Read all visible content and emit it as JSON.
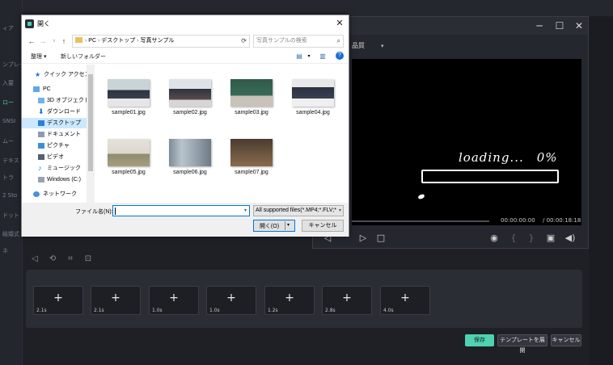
{
  "editor": {
    "left_labels": [
      "ィア",
      "ンプレー",
      "入要",
      "ロー",
      "SNSI",
      "ムー",
      "テキス",
      "トラ",
      "2 Sto",
      "ドット",
      "結婚式",
      "ネ"
    ],
    "preview": {
      "quality_label": "品質",
      "loading_text": "loading...",
      "loading_percent": "0%",
      "timecode_current": "00:00:00:00",
      "timecode_total": "/ 00:00:18:18"
    },
    "slots": [
      {
        "plus": "+",
        "duration": "2.1s"
      },
      {
        "plus": "+",
        "duration": "2.1s"
      },
      {
        "plus": "+",
        "duration": "1.0s"
      },
      {
        "plus": "+",
        "duration": "1.0s"
      },
      {
        "plus": "+",
        "duration": "1.2s"
      },
      {
        "plus": "+",
        "duration": "2.8s"
      },
      {
        "plus": "+",
        "duration": "4.0s"
      }
    ],
    "buttons": {
      "save": "保存",
      "expand_template": "テンプレートを展開",
      "cancel": "キャンセル"
    },
    "accent_color": "#4fd1b2"
  },
  "dialog": {
    "title": "開く",
    "breadcrumb": [
      "PC",
      "デスクトップ",
      "写真サンプル"
    ],
    "search_placeholder": "写真サンプルの検索",
    "toolbar": {
      "organize": "整理",
      "new_folder": "新しいフォルダー"
    },
    "nav_items": [
      {
        "label": "クイック アクセス",
        "icon": "star-icon"
      },
      {
        "label": "PC",
        "icon": "pc-icon"
      },
      {
        "label": "3D オブジェクト",
        "icon": "cube-icon"
      },
      {
        "label": "ダウンロード",
        "icon": "download-icon"
      },
      {
        "label": "デスクトップ",
        "icon": "desktop-icon",
        "selected": true
      },
      {
        "label": "ドキュメント",
        "icon": "document-icon"
      },
      {
        "label": "ピクチャ",
        "icon": "picture-icon"
      },
      {
        "label": "ビデオ",
        "icon": "video-icon"
      },
      {
        "label": "ミュージック",
        "icon": "music-icon"
      },
      {
        "label": "Windows (C:)",
        "icon": "drive-icon"
      },
      {
        "label": "ネットワーク",
        "icon": "network-icon"
      }
    ],
    "files": [
      {
        "name": "sample01.jpg"
      },
      {
        "name": "sample02.jpg"
      },
      {
        "name": "sample03.jpg"
      },
      {
        "name": "sample04.jpg"
      },
      {
        "name": "sample05.jpg"
      },
      {
        "name": "sample06.jpg"
      },
      {
        "name": "sample07.jpg"
      }
    ],
    "filename_label": "ファイル名(N):",
    "filename_value": "",
    "file_type_filter": "All supported files(*.MP4;*.FLV;*",
    "open_button": "開く(O)",
    "cancel_button": "キャンセル",
    "accent_color": "#0078d7"
  }
}
